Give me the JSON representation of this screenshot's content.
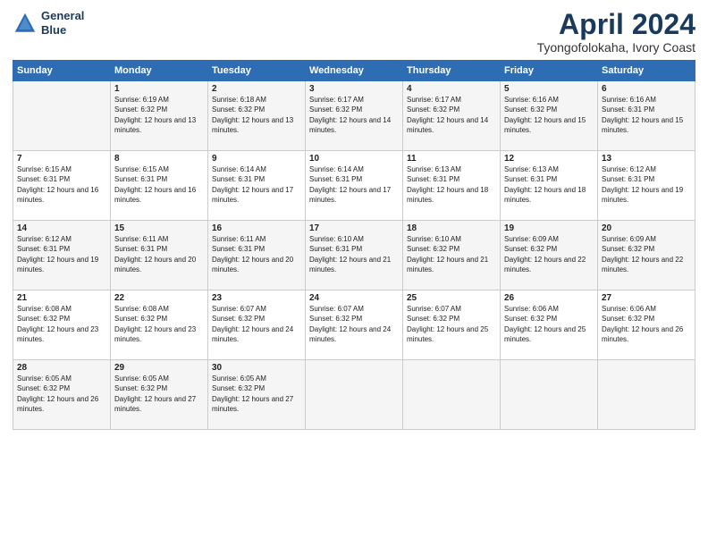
{
  "header": {
    "logo_line1": "General",
    "logo_line2": "Blue",
    "month_title": "April 2024",
    "location": "Tyongofolokaha, Ivory Coast"
  },
  "days_of_week": [
    "Sunday",
    "Monday",
    "Tuesday",
    "Wednesday",
    "Thursday",
    "Friday",
    "Saturday"
  ],
  "weeks": [
    [
      {
        "num": "",
        "sunrise": "",
        "sunset": "",
        "daylight": ""
      },
      {
        "num": "1",
        "sunrise": "Sunrise: 6:19 AM",
        "sunset": "Sunset: 6:32 PM",
        "daylight": "Daylight: 12 hours and 13 minutes."
      },
      {
        "num": "2",
        "sunrise": "Sunrise: 6:18 AM",
        "sunset": "Sunset: 6:32 PM",
        "daylight": "Daylight: 12 hours and 13 minutes."
      },
      {
        "num": "3",
        "sunrise": "Sunrise: 6:17 AM",
        "sunset": "Sunset: 6:32 PM",
        "daylight": "Daylight: 12 hours and 14 minutes."
      },
      {
        "num": "4",
        "sunrise": "Sunrise: 6:17 AM",
        "sunset": "Sunset: 6:32 PM",
        "daylight": "Daylight: 12 hours and 14 minutes."
      },
      {
        "num": "5",
        "sunrise": "Sunrise: 6:16 AM",
        "sunset": "Sunset: 6:32 PM",
        "daylight": "Daylight: 12 hours and 15 minutes."
      },
      {
        "num": "6",
        "sunrise": "Sunrise: 6:16 AM",
        "sunset": "Sunset: 6:31 PM",
        "daylight": "Daylight: 12 hours and 15 minutes."
      }
    ],
    [
      {
        "num": "7",
        "sunrise": "Sunrise: 6:15 AM",
        "sunset": "Sunset: 6:31 PM",
        "daylight": "Daylight: 12 hours and 16 minutes."
      },
      {
        "num": "8",
        "sunrise": "Sunrise: 6:15 AM",
        "sunset": "Sunset: 6:31 PM",
        "daylight": "Daylight: 12 hours and 16 minutes."
      },
      {
        "num": "9",
        "sunrise": "Sunrise: 6:14 AM",
        "sunset": "Sunset: 6:31 PM",
        "daylight": "Daylight: 12 hours and 17 minutes."
      },
      {
        "num": "10",
        "sunrise": "Sunrise: 6:14 AM",
        "sunset": "Sunset: 6:31 PM",
        "daylight": "Daylight: 12 hours and 17 minutes."
      },
      {
        "num": "11",
        "sunrise": "Sunrise: 6:13 AM",
        "sunset": "Sunset: 6:31 PM",
        "daylight": "Daylight: 12 hours and 18 minutes."
      },
      {
        "num": "12",
        "sunrise": "Sunrise: 6:13 AM",
        "sunset": "Sunset: 6:31 PM",
        "daylight": "Daylight: 12 hours and 18 minutes."
      },
      {
        "num": "13",
        "sunrise": "Sunrise: 6:12 AM",
        "sunset": "Sunset: 6:31 PM",
        "daylight": "Daylight: 12 hours and 19 minutes."
      }
    ],
    [
      {
        "num": "14",
        "sunrise": "Sunrise: 6:12 AM",
        "sunset": "Sunset: 6:31 PM",
        "daylight": "Daylight: 12 hours and 19 minutes."
      },
      {
        "num": "15",
        "sunrise": "Sunrise: 6:11 AM",
        "sunset": "Sunset: 6:31 PM",
        "daylight": "Daylight: 12 hours and 20 minutes."
      },
      {
        "num": "16",
        "sunrise": "Sunrise: 6:11 AM",
        "sunset": "Sunset: 6:31 PM",
        "daylight": "Daylight: 12 hours and 20 minutes."
      },
      {
        "num": "17",
        "sunrise": "Sunrise: 6:10 AM",
        "sunset": "Sunset: 6:31 PM",
        "daylight": "Daylight: 12 hours and 21 minutes."
      },
      {
        "num": "18",
        "sunrise": "Sunrise: 6:10 AM",
        "sunset": "Sunset: 6:32 PM",
        "daylight": "Daylight: 12 hours and 21 minutes."
      },
      {
        "num": "19",
        "sunrise": "Sunrise: 6:09 AM",
        "sunset": "Sunset: 6:32 PM",
        "daylight": "Daylight: 12 hours and 22 minutes."
      },
      {
        "num": "20",
        "sunrise": "Sunrise: 6:09 AM",
        "sunset": "Sunset: 6:32 PM",
        "daylight": "Daylight: 12 hours and 22 minutes."
      }
    ],
    [
      {
        "num": "21",
        "sunrise": "Sunrise: 6:08 AM",
        "sunset": "Sunset: 6:32 PM",
        "daylight": "Daylight: 12 hours and 23 minutes."
      },
      {
        "num": "22",
        "sunrise": "Sunrise: 6:08 AM",
        "sunset": "Sunset: 6:32 PM",
        "daylight": "Daylight: 12 hours and 23 minutes."
      },
      {
        "num": "23",
        "sunrise": "Sunrise: 6:07 AM",
        "sunset": "Sunset: 6:32 PM",
        "daylight": "Daylight: 12 hours and 24 minutes."
      },
      {
        "num": "24",
        "sunrise": "Sunrise: 6:07 AM",
        "sunset": "Sunset: 6:32 PM",
        "daylight": "Daylight: 12 hours and 24 minutes."
      },
      {
        "num": "25",
        "sunrise": "Sunrise: 6:07 AM",
        "sunset": "Sunset: 6:32 PM",
        "daylight": "Daylight: 12 hours and 25 minutes."
      },
      {
        "num": "26",
        "sunrise": "Sunrise: 6:06 AM",
        "sunset": "Sunset: 6:32 PM",
        "daylight": "Daylight: 12 hours and 25 minutes."
      },
      {
        "num": "27",
        "sunrise": "Sunrise: 6:06 AM",
        "sunset": "Sunset: 6:32 PM",
        "daylight": "Daylight: 12 hours and 26 minutes."
      }
    ],
    [
      {
        "num": "28",
        "sunrise": "Sunrise: 6:05 AM",
        "sunset": "Sunset: 6:32 PM",
        "daylight": "Daylight: 12 hours and 26 minutes."
      },
      {
        "num": "29",
        "sunrise": "Sunrise: 6:05 AM",
        "sunset": "Sunset: 6:32 PM",
        "daylight": "Daylight: 12 hours and 27 minutes."
      },
      {
        "num": "30",
        "sunrise": "Sunrise: 6:05 AM",
        "sunset": "Sunset: 6:32 PM",
        "daylight": "Daylight: 12 hours and 27 minutes."
      },
      {
        "num": "",
        "sunrise": "",
        "sunset": "",
        "daylight": ""
      },
      {
        "num": "",
        "sunrise": "",
        "sunset": "",
        "daylight": ""
      },
      {
        "num": "",
        "sunrise": "",
        "sunset": "",
        "daylight": ""
      },
      {
        "num": "",
        "sunrise": "",
        "sunset": "",
        "daylight": ""
      }
    ]
  ]
}
